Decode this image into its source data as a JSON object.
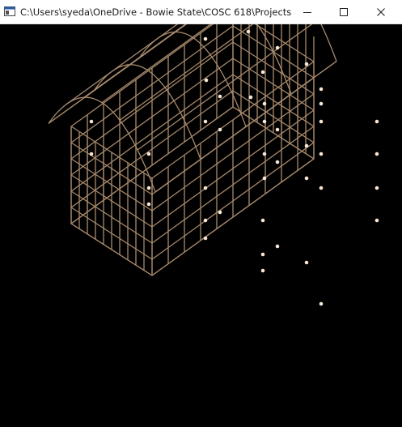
{
  "window": {
    "title": "C:\\Users\\syeda\\OneDrive - Bowie State\\COSC 618\\Projects\\P...",
    "controls": {
      "minimize_icon": "minimize-icon",
      "maximize_icon": "maximize-icon",
      "close_icon": "close-icon"
    }
  },
  "scene": {
    "background_color": "#000000",
    "wire_color": "#a7896b",
    "point_color": "#f6e6d6",
    "object": "wireframe quonset-style hut",
    "control_points_visible": true
  }
}
